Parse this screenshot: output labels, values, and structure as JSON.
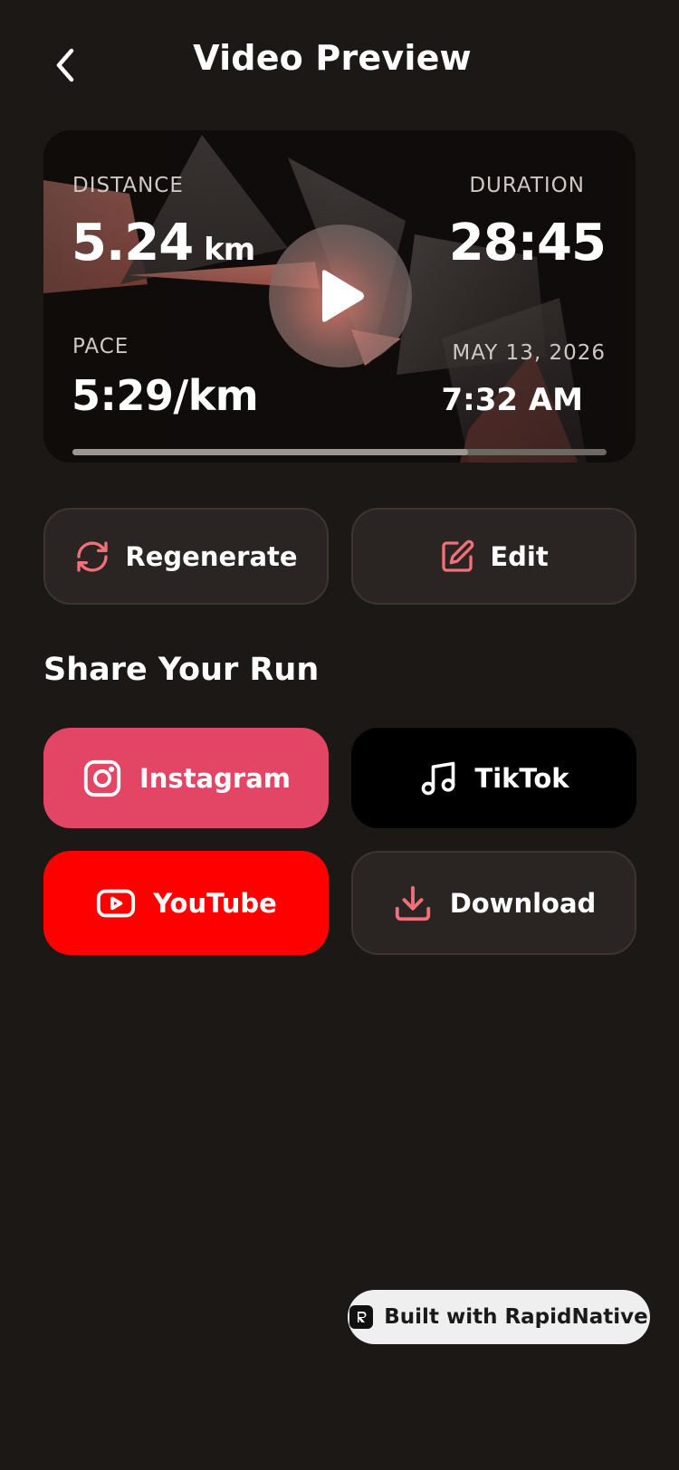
{
  "header": {
    "title": "Video Preview",
    "back_icon": "chevron-left-icon"
  },
  "preview": {
    "distance_label": "DISTANCE",
    "distance_value": "5.24",
    "distance_unit": "km",
    "duration_label": "DURATION",
    "duration_value": "28:45",
    "pace_label": "PACE",
    "pace_value": "5:29/km",
    "date_label": "MAY 13, 2026",
    "time_value": "7:32 AM",
    "play_icon": "play-icon",
    "progress_fraction": 0.74
  },
  "actions": {
    "regenerate_label": "Regenerate",
    "regenerate_icon": "refresh-icon",
    "edit_label": "Edit",
    "edit_icon": "edit-icon"
  },
  "share": {
    "title": "Share Your Run",
    "instagram_label": "Instagram",
    "tiktok_label": "TikTok",
    "youtube_label": "YouTube",
    "download_label": "Download"
  },
  "badge": {
    "label": "Built with RapidNative"
  },
  "colors": {
    "background": "#1c1816",
    "accent": "#f07179",
    "instagram": "#e24664",
    "tiktok": "#000000",
    "youtube": "#ff0000",
    "surface": "#2a2422"
  }
}
